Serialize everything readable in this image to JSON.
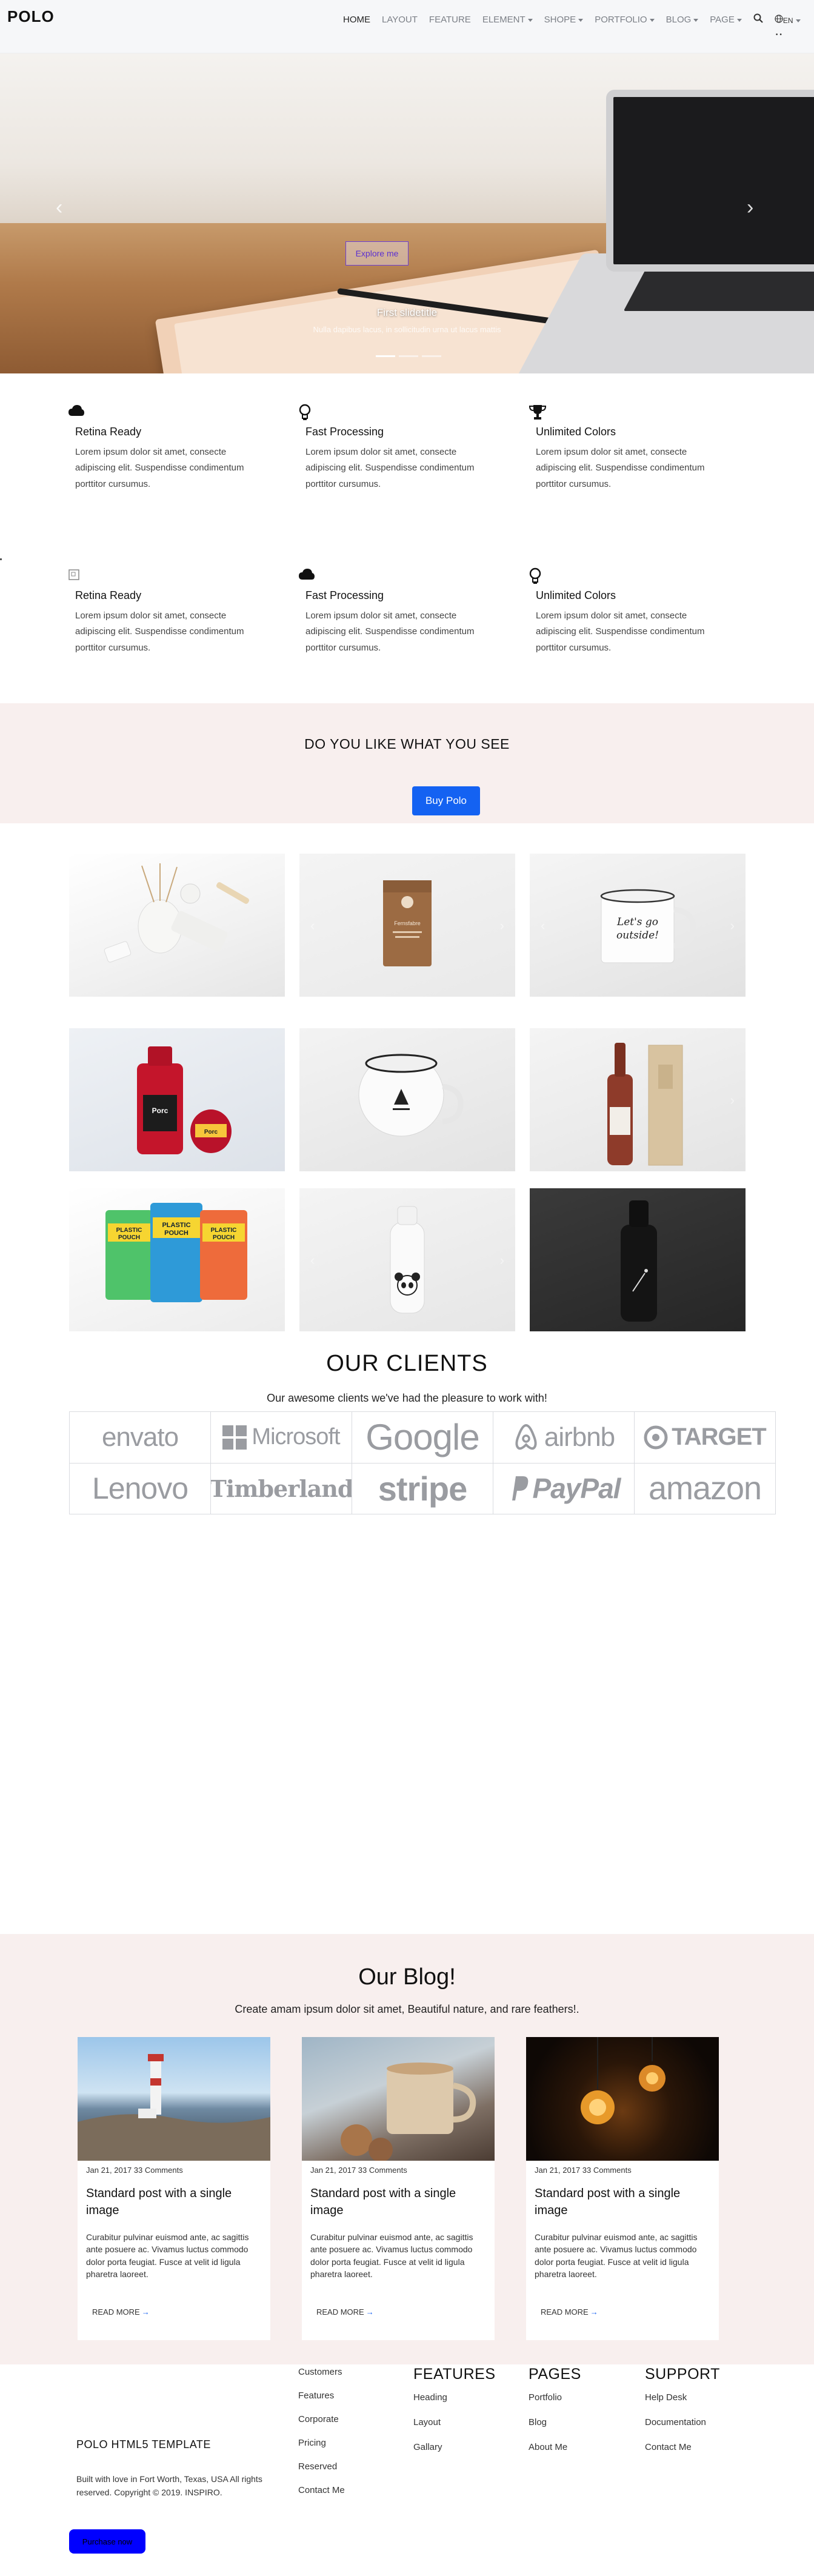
{
  "header": {
    "logo": "POLO",
    "nav": [
      {
        "label": "HOME",
        "caret": false,
        "active": true
      },
      {
        "label": "LAYOUT",
        "caret": false,
        "active": false
      },
      {
        "label": "FEATURE",
        "caret": false,
        "active": false
      },
      {
        "label": "ELEMENT",
        "caret": true,
        "active": false
      },
      {
        "label": "SHOPE",
        "caret": true,
        "active": false
      },
      {
        "label": "PORTFOLIO",
        "caret": true,
        "active": false
      },
      {
        "label": "BLOG",
        "caret": true,
        "active": false
      },
      {
        "label": "PAGE",
        "caret": true,
        "active": false
      }
    ],
    "search_icon": "search-icon",
    "language": "EN"
  },
  "hero": {
    "button_label": "Explore me",
    "caption_title": "First slidetitle",
    "caption_sub": "Nulla dapibus lacus, in sollicitudin urna ut lacus mattis",
    "slide_count": 3,
    "active_slide": 1
  },
  "features": [
    {
      "icon": "cloud-icon",
      "glyph": "☁",
      "title": "Retina Ready",
      "text": "Lorem ipsum dolor sit amet, consecte adipiscing elit. Suspendisse condimentum porttitor cursumus."
    },
    {
      "icon": "lightbulb-icon",
      "glyph": "💡",
      "title": "Fast Processing",
      "text": "Lorem ipsum dolor sit amet, consecte adipiscing elit. Suspendisse condimentum porttitor cursumus."
    },
    {
      "icon": "trophy-icon",
      "glyph": "🏆",
      "title": "Unlimited Colors",
      "text": "Lorem ipsum dolor sit amet, consecte adipiscing elit. Suspendisse condimentum porttitor cursumus."
    },
    {
      "icon": "broken-image-icon",
      "glyph": "▫",
      "title": "Retina Ready",
      "text": "Lorem ipsum dolor sit amet, consecte adipiscing elit. Suspendisse condimentum porttitor cursumus."
    },
    {
      "icon": "cloud-icon",
      "glyph": "☁",
      "title": "Fast Processing",
      "text": "Lorem ipsum dolor sit amet, consecte adipiscing elit. Suspendisse condimentum porttitor cursumus."
    },
    {
      "icon": "lightbulb-icon",
      "glyph": "💡",
      "title": "Unlimited Colors",
      "text": "Lorem ipsum dolor sit amet, consecte adipiscing elit. Suspendisse condimentum porttitor cursumus."
    }
  ],
  "cta": {
    "title": "DO YOU LIKE WHAT YOU SEE",
    "button": "Buy Polo",
    "button_color": "#1462f2"
  },
  "products": [
    {
      "name": "diffuser-set-image"
    },
    {
      "name": "coffee-pouch-image",
      "label": "Fernsfabre"
    },
    {
      "name": "enamel-mug-lets-go-outside-image",
      "label": "Let's go outside!"
    },
    {
      "name": "juice-bottle-and-jar-image",
      "label": "Porc"
    },
    {
      "name": "white-enamel-mug-image"
    },
    {
      "name": "wine-bottle-and-box-image"
    },
    {
      "name": "plastic-pouches-image",
      "label": "PLASTIC POUCH"
    },
    {
      "name": "panda-bottle-image"
    },
    {
      "name": "black-bottle-image"
    }
  ],
  "clients": {
    "title": "OUR CLIENTS",
    "subtitle": "Our awesome clients we've had the pleasure to work with!",
    "logos": [
      "envato",
      "Microsoft",
      "Google",
      "airbnb",
      "TARGET",
      "Lenovo",
      "Timberland",
      "stripe",
      "PayPal",
      "amazon"
    ]
  },
  "blog": {
    "title": "Our Blog!",
    "subtitle": "Create amam ipsum dolor sit amet, Beautiful nature, and rare feathers!.",
    "posts": [
      {
        "image": "lighthouse-image",
        "meta": "Jan 21, 2017 33 Comments",
        "title": "Standard post with a single image",
        "excerpt": "Curabitur pulvinar euismod ante, ac sagittis ante posuere ac. Vivamus luctus commodo dolor porta feugiat. Fusce at velit id ligula pharetra laoreet.",
        "more": "READ MORE"
      },
      {
        "image": "coffee-mug-image",
        "meta": "Jan 21, 2017 33 Comments",
        "title": "Standard post with a single image",
        "excerpt": "Curabitur pulvinar euismod ante, ac sagittis ante posuere ac. Vivamus luctus commodo dolor porta feugiat. Fusce at velit id ligula pharetra laoreet.",
        "more": "READ MORE"
      },
      {
        "image": "lightbulbs-image",
        "meta": "Jan 21, 2017 33 Comments",
        "title": "Standard post with a single image",
        "excerpt": "Curabitur pulvinar euismod ante, ac sagittis ante posuere ac. Vivamus luctus commodo dolor porta feugiat. Fusce at velit id ligula pharetra laoreet.",
        "more": "READ MORE"
      }
    ]
  },
  "footer": {
    "col1_links": [
      "Customers",
      "Features",
      "Corporate",
      "Pricing",
      "Reserved",
      "Contact Me"
    ],
    "features_heading": "FEATURES",
    "features_links": [
      "Heading",
      "Layout",
      "Gallary"
    ],
    "pages_heading": "PAGES",
    "pages_links": [
      "Portfolio",
      "Blog",
      "About Me"
    ],
    "support_heading": "SUPPORT",
    "support_links": [
      "Help Desk",
      "Documentation",
      "Contact Me"
    ],
    "template_title": "POLO HTML5 TEMPLATE",
    "copyright": "Built with love in Fort Worth, Texas, USA All rights reserved. Copyright © 2019. INSPIRO.",
    "button_label": "Purchase now",
    "button_color": "#0000ff"
  }
}
